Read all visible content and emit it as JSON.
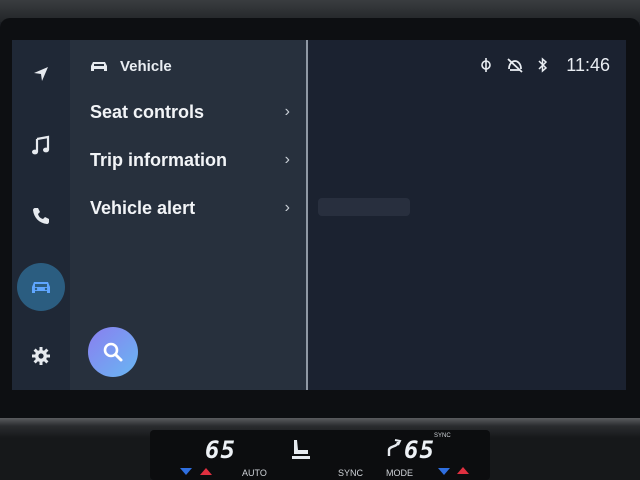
{
  "rail": {
    "items": [
      {
        "icon": "navigation-icon"
      },
      {
        "icon": "music-icon"
      },
      {
        "icon": "phone-icon"
      },
      {
        "icon": "vehicle-icon"
      },
      {
        "icon": "settings-icon"
      }
    ],
    "active_index": 3
  },
  "menu": {
    "header": "Vehicle",
    "items": [
      {
        "label": "Seat controls"
      },
      {
        "label": "Trip information"
      },
      {
        "label": "Vehicle alert"
      }
    ],
    "search_icon": "search-icon"
  },
  "status": {
    "time": "11:46",
    "icons": [
      "wireless-charging-icon",
      "mic-muted-icon",
      "bluetooth-icon"
    ]
  },
  "climate": {
    "left_temp": "65",
    "right_temp": "65",
    "sync_superscript": "SYNC",
    "labels": [
      "AUTO",
      "SYNC",
      "MODE"
    ]
  },
  "colors": {
    "accent": "#2b5d80",
    "vehicle_icon": "#5fa6ff",
    "search_gradient_start": "#8a7ef0",
    "search_gradient_end": "#68b7f2"
  }
}
